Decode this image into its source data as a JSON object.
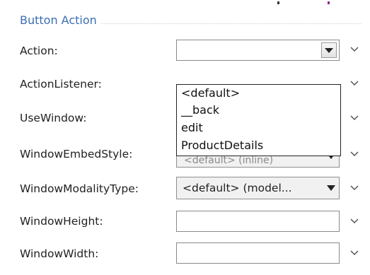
{
  "section": {
    "title": "Button Action"
  },
  "properties": [
    {
      "label": "Action:",
      "value": ""
    },
    {
      "label": "ActionListener:",
      "value": ""
    },
    {
      "label": "UseWindow:",
      "value": ""
    },
    {
      "label": "WindowEmbedStyle:",
      "value": "<default> (inline)"
    },
    {
      "label": "WindowModalityType:",
      "value": "<default> (model..."
    },
    {
      "label": "WindowHeight:",
      "value": ""
    },
    {
      "label": "WindowWidth:",
      "value": ""
    }
  ],
  "action_dropdown": {
    "options": [
      "<default>",
      "__back",
      "edit",
      "ProductDetails"
    ]
  },
  "icons": {
    "dropdown_arrow": "triangle-down-icon",
    "row_menu": "chevron-down-icon"
  },
  "colors": {
    "section_title": "#3a6fb3",
    "field_border": "#8a8a8a",
    "dropdown_border": "#222222"
  }
}
